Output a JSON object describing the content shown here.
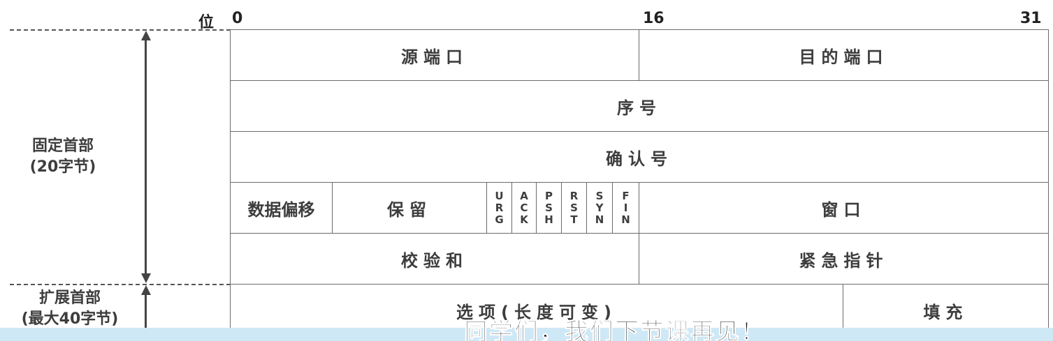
{
  "bit_labels": {
    "wei": "位",
    "b0": "0",
    "b16": "16",
    "b31": "31"
  },
  "side": {
    "fixed_line1": "固定首部",
    "fixed_line2": "(20字节)",
    "ext_line1": "扩展首部",
    "ext_line2": "(最大40字节)"
  },
  "fields": {
    "src_port": "源端口",
    "dst_port": "目的端口",
    "seq": "序号",
    "ack_num": "确认号",
    "data_offset": "数据偏移",
    "reserved": "保留",
    "window": "窗口",
    "checksum": "校验和",
    "urgent_ptr": "紧急指针",
    "options": "选项(长度可变)",
    "padding": "填充"
  },
  "flags": [
    {
      "l1": "U",
      "l2": "R",
      "l3": "G"
    },
    {
      "l1": "A",
      "l2": "C",
      "l3": "K"
    },
    {
      "l1": "P",
      "l2": "S",
      "l3": "H"
    },
    {
      "l1": "R",
      "l2": "S",
      "l3": "T"
    },
    {
      "l1": "S",
      "l2": "Y",
      "l3": "N"
    },
    {
      "l1": "F",
      "l2": "I",
      "l3": "N"
    }
  ],
  "caption": "同学们，我们下节课再见！"
}
